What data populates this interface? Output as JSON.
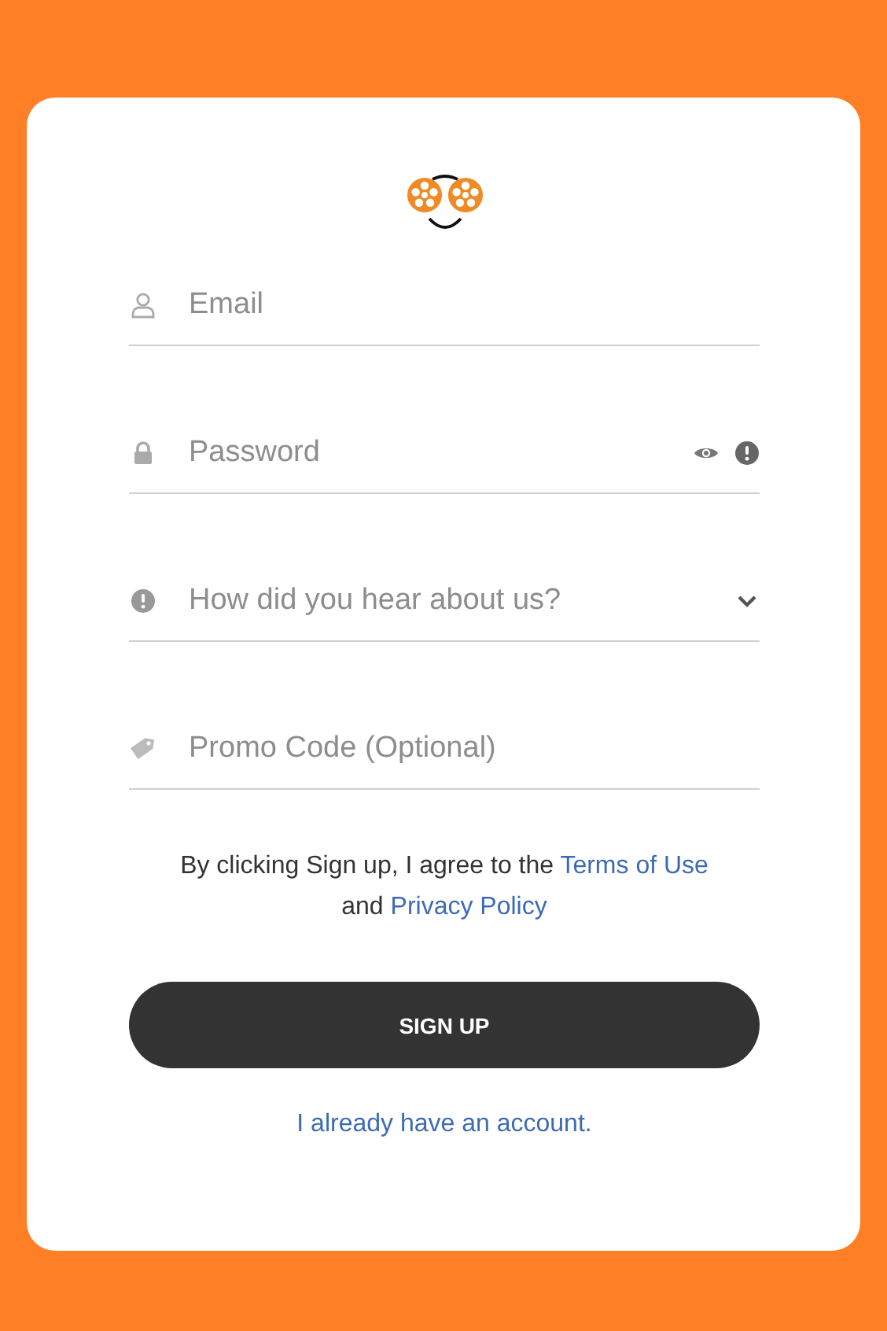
{
  "fields": [
    {
      "kind": "email",
      "placeholder": "Email"
    },
    {
      "kind": "password",
      "placeholder": "Password"
    },
    {
      "kind": "select",
      "placeholder": "How did you hear about us?"
    },
    {
      "kind": "promo",
      "placeholder": "Promo Code (Optional)"
    }
  ],
  "agreement": {
    "text_before": "By clicking Sign up, I agree to the",
    "terms_link": "Terms of Use",
    "text_between": "and",
    "privacy_link": "Privacy Policy"
  },
  "submit_button": "SIGN UP",
  "login_link": "I already have an account."
}
